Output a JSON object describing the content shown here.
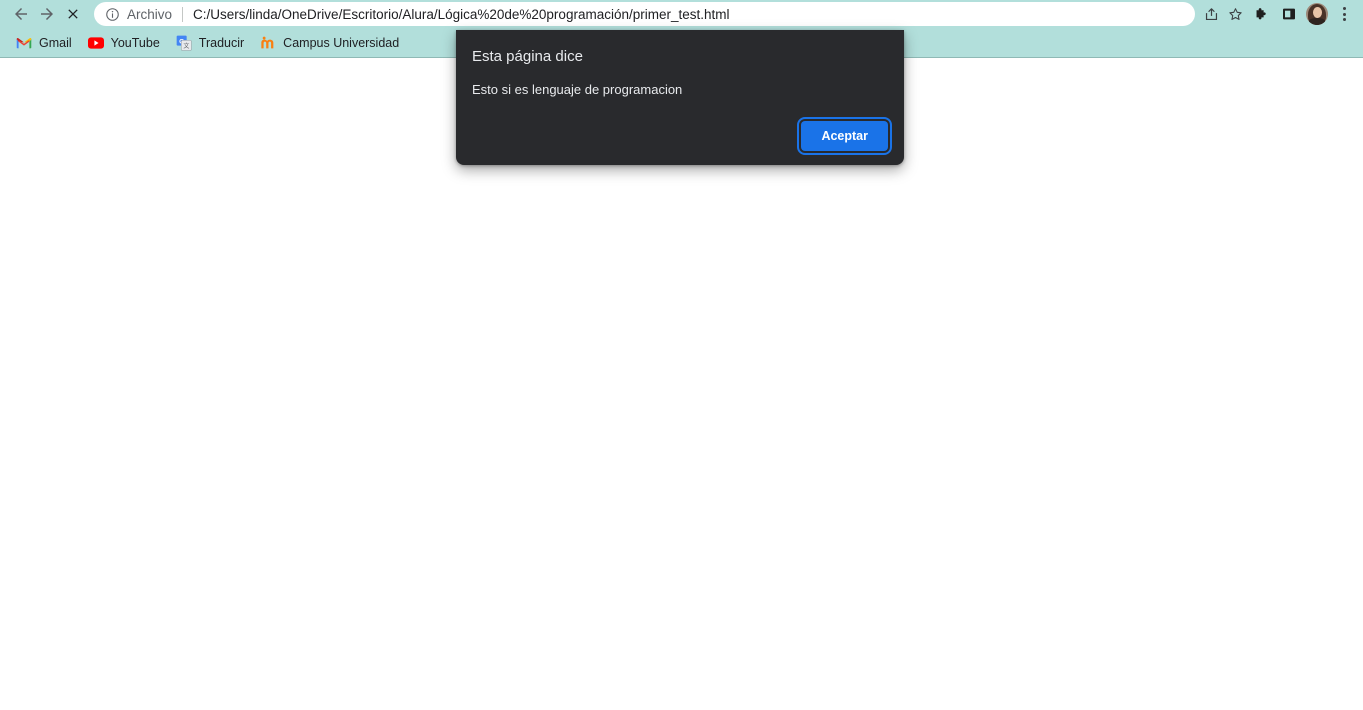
{
  "browser": {
    "nav": {
      "back_label": "Back",
      "forward_label": "Forward",
      "stop_label": "Stop loading"
    },
    "omnibox": {
      "site_info_label": "View site information",
      "scheme_label": "Archivo",
      "url": "C:/Users/linda/OneDrive/Escritorio/Alura/Lógica%20de%20programación/primer_test.html",
      "share_label": "Share this page",
      "bookmark_label": "Bookmark this tab"
    },
    "toolbar_right": {
      "extensions_label": "Extensions",
      "side_panel_label": "Side panel",
      "profile_label": "Profile",
      "menu_label": "Customize and control Google Chrome"
    },
    "bookmarks": [
      {
        "label": "Gmail",
        "icon": "gmail-icon"
      },
      {
        "label": "YouTube",
        "icon": "youtube-icon"
      },
      {
        "label": "Traducir",
        "icon": "google-translate-icon"
      },
      {
        "label": "Campus Universidad",
        "icon": "moodle-icon"
      }
    ],
    "colors": {
      "chrome_background": "#b2dfdb",
      "omnibox_background": "#ffffff",
      "page_background": "#ffffff",
      "dialog_background": "#292a2d",
      "dialog_button": "#1a73e8"
    }
  },
  "dialog": {
    "title": "Esta página dice",
    "message": "Esto si es lenguaje de programacion",
    "ok_label": "Aceptar"
  }
}
